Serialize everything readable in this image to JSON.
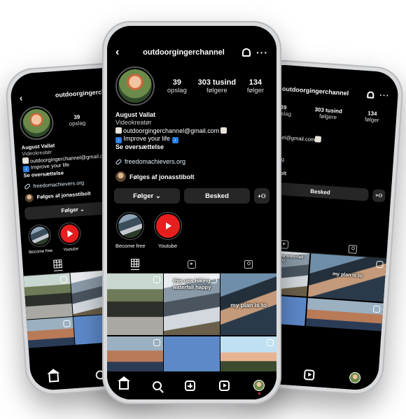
{
  "profile": {
    "username": "outdoorgingerchannel",
    "posts_count": "39",
    "posts_label": "opslag",
    "followers_count": "303 tusind",
    "followers_label": "følgere",
    "following_count": "134",
    "following_label": "følger",
    "display_name": "August Vallat",
    "category": "Videokreatør",
    "bio_email": "outdoorgingerchannel@gmail.com",
    "bio_line2": "Improve your life",
    "translate": "Se oversættelse",
    "link": "freedomachievers.org",
    "followed_by": "Følges af jonasstibolt"
  },
  "actions": {
    "follow_label": "Følger",
    "message_label": "Besked",
    "add_person_label": "+⎇"
  },
  "highlights": [
    {
      "label": "Become free"
    },
    {
      "label": "Youtube"
    }
  ],
  "posts": {
    "captions": [
      "this ups hiking waterfall happy",
      "my plan is to"
    ]
  },
  "colors": {
    "background": "#000000",
    "button": "#262626",
    "youtube_red": "#e61e1e",
    "link": "#e0f1ff",
    "notification_dot": "#ff2d55"
  },
  "icons": [
    "back-arrow-icon",
    "bell-icon",
    "more-dots-icon",
    "link-icon",
    "grid-icon",
    "reels-icon",
    "tagged-icon",
    "home-icon",
    "search-icon",
    "create-icon",
    "reels-nav-icon",
    "profile-avatar-icon"
  ]
}
